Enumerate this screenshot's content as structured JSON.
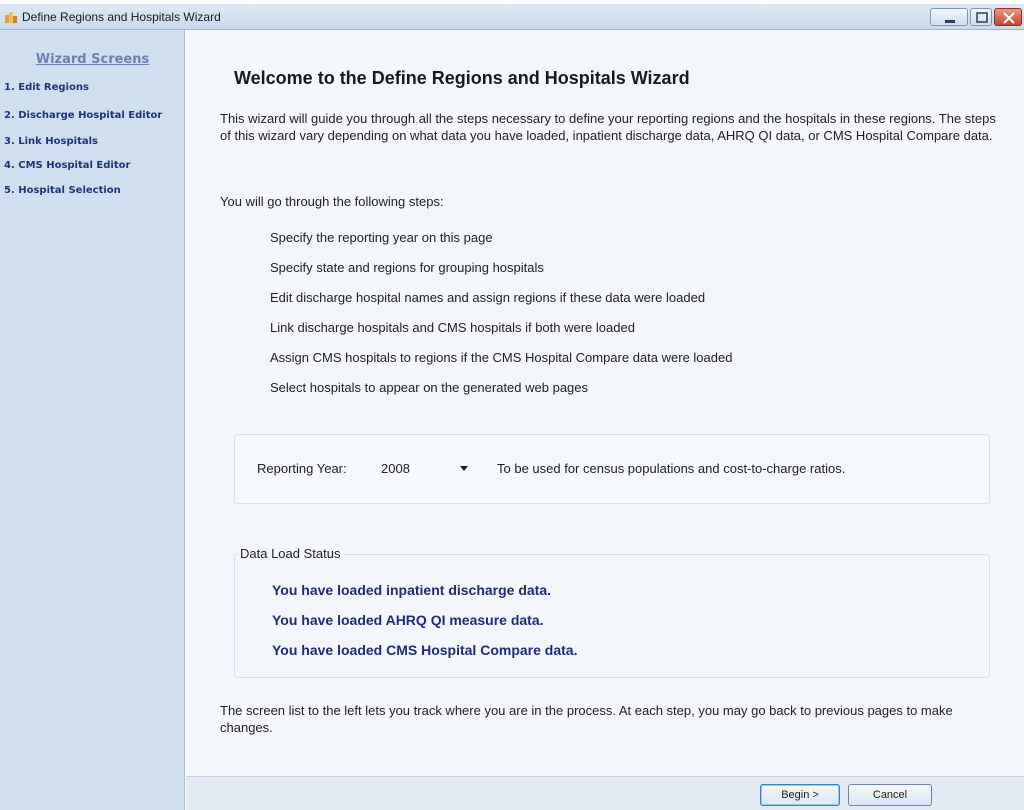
{
  "window": {
    "title": "Define Regions and Hospitals Wizard"
  },
  "sidebar": {
    "heading": "Wizard Screens",
    "items": [
      {
        "label": "1. Edit Regions"
      },
      {
        "label": "2. Discharge Hospital Editor"
      },
      {
        "label": "3. Link Hospitals"
      },
      {
        "label": "4. CMS Hospital Editor"
      },
      {
        "label": "5. Hospital Selection"
      }
    ]
  },
  "main": {
    "title": "Welcome to the Define Regions and Hospitals Wizard",
    "intro": "This wizard will guide you through all the steps necessary to define your reporting regions and the hospitals in these regions. The steps of this wizard vary depending on what data you have loaded, inpatient discharge data, AHRQ QI data, or CMS Hospital Compare data.",
    "steps_intro": "You will go through the following steps:",
    "steps": [
      "Specify the reporting year on this page",
      "Specify state and regions for grouping hospitals",
      "Edit discharge hospital names and assign regions if these data were loaded",
      "Link discharge hospitals and CMS hospitals if both were loaded",
      "Assign CMS hospitals to regions if the CMS Hospital Compare data were loaded",
      "Select hospitals to appear on the generated web pages"
    ],
    "reporting_year": {
      "label": "Reporting Year:",
      "value": "2008",
      "note": "To be used for census populations and cost-to-charge ratios."
    },
    "data_load_status": {
      "legend": "Data Load Status",
      "lines": [
        "You have loaded inpatient discharge data.",
        "You have loaded AHRQ QI measure data.",
        "You have loaded CMS Hospital Compare data."
      ]
    },
    "footer_note": "The screen list to the left lets you track where you are in the process. At each step, you may go back to previous pages to make changes."
  },
  "buttons": {
    "begin": "Begin >",
    "cancel": "Cancel"
  },
  "colors": {
    "sidebar_bg": "#cfdff0",
    "sidebar_link": "#1f3478",
    "status_text": "#1f2a7a",
    "content_bg": "#f3f7fb"
  },
  "icons": {
    "app": "app-icon",
    "minimize": "minimize-icon",
    "maximize": "maximize-icon",
    "close": "close-icon",
    "dropdown": "chevron-down-icon"
  }
}
